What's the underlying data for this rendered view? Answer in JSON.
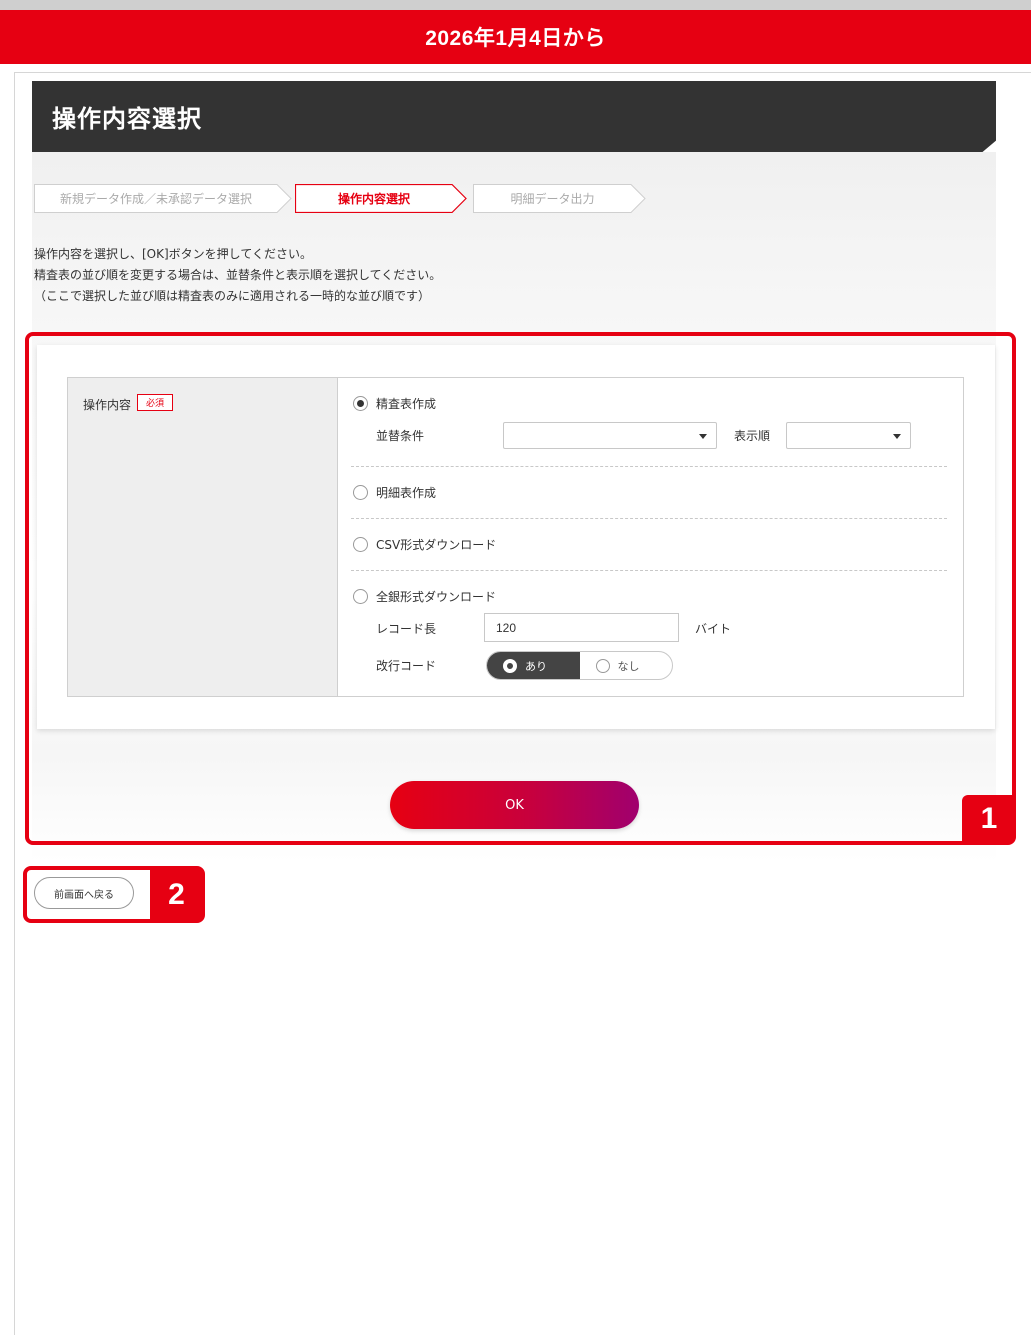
{
  "banner": {
    "text": "2026年1月4日から"
  },
  "page_title": "操作内容選択",
  "steps": {
    "step1": "新規データ作成／未承認データ選択",
    "step2": "操作内容選択",
    "step3": "明細データ出力",
    "active_index": 2
  },
  "instructions": {
    "line1": "操作内容を選択し、[OK]ボタンを押してください。",
    "line2": "精査表の並び順を変更する場合は、並替条件と表示順を選択してください。",
    "line3": "（ここで選択した並び順は精査表のみに適用される一時的な並び順です）"
  },
  "form": {
    "label": "操作内容",
    "required_badge": "必須",
    "options": {
      "seisa": {
        "label": "精査表作成",
        "checked": true
      },
      "meisai": {
        "label": "明細表作成",
        "checked": false
      },
      "csv": {
        "label": "CSV形式ダウンロード",
        "checked": false
      },
      "zengin": {
        "label": "全銀形式ダウンロード",
        "checked": false
      }
    },
    "sort_condition_label": "並替条件",
    "sort_condition_value": "",
    "display_order_label": "表示順",
    "display_order_value": "",
    "record_length_label": "レコード長",
    "record_length_value": "120",
    "record_length_unit": "バイト",
    "newline_label": "改行コード",
    "newline_on": "あり",
    "newline_off": "なし",
    "newline_selected": "あり"
  },
  "ok_button": "OK",
  "back_button": "前画面へ戻る",
  "markers": {
    "m1": "1",
    "m2": "2"
  },
  "colors": {
    "accent": "#e60012",
    "title_bar": "#333333",
    "gradient_end": "#a0006e"
  }
}
